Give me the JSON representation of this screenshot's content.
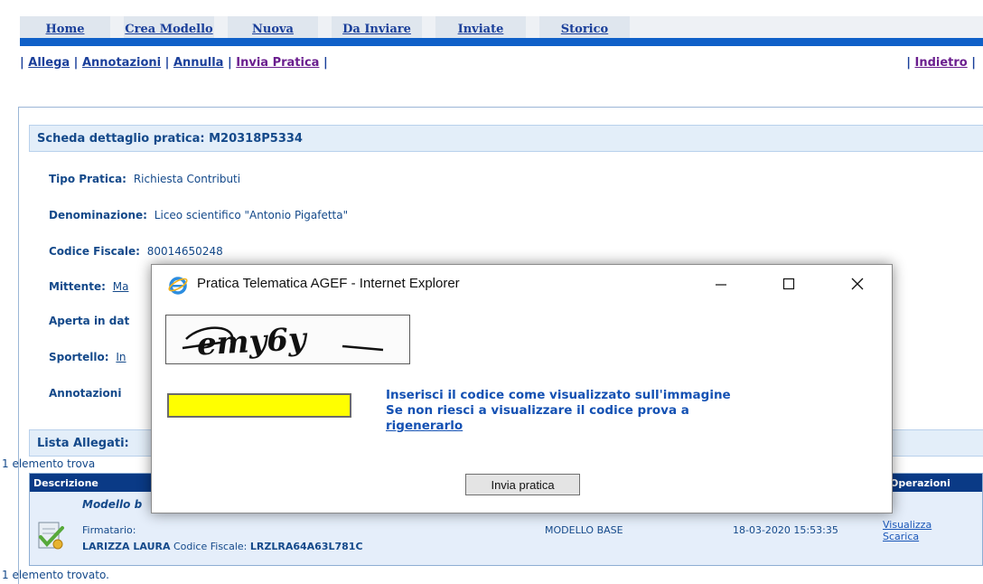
{
  "nav": {
    "tabs": [
      "Home",
      "Crea Modello",
      "Nuova",
      "Da Inviare",
      "Inviate",
      "Storico"
    ]
  },
  "actions": {
    "allega": "Allega",
    "annotazioni": "Annotazioni",
    "annulla": "Annulla",
    "invia_pratica": "Invia Pratica",
    "indietro": "Indietro"
  },
  "scheda": {
    "title": "Scheda dettaglio pratica: M20318P5334",
    "tipo_label": "Tipo Pratica:",
    "tipo_value": "Richiesta Contributi",
    "denominazione_label": "Denominazione:",
    "denominazione_value": "Liceo scientifico \"Antonio Pigafetta\"",
    "cf_label": "Codice Fiscale:",
    "cf_value": "80014650248",
    "mittente_label": "Mittente:",
    "mittente_value": "Ma",
    "aperta_label": "Aperta in dat",
    "sportello_label": "Sportello:",
    "sportello_value": "In",
    "annotazioni_label": "Annotazioni"
  },
  "allegati": {
    "title": "Lista Allegati:",
    "count_top": "1 elemento trova",
    "count_bottom": "1 elemento trovato.",
    "headers": {
      "descrizione": "Descrizione",
      "operazioni": "Operazioni"
    },
    "row": {
      "modello": "Modello b",
      "firmatario_label": "Firmatario:",
      "firmatario_name": "LARIZZA LAURA",
      "cf_label": "Codice Fiscale:",
      "cf_value": "LRZLRA64A63L781C",
      "tipo": "MODELLO BASE",
      "data": "18-03-2020 15:53:35",
      "visualizza": "Visualizza",
      "scarica": "Scarica"
    }
  },
  "dialog": {
    "title": "Pratica Telematica AGEF - Internet Explorer",
    "captcha_text": "emy6y",
    "input_value": "",
    "instr_line1": "Inserisci il codice come visualizzato sull'immagine",
    "instr_line2": "Se non riesci a visualizzare il codice prova a",
    "rigenera_link": "rigenerarlo",
    "send_button": "Invia pratica"
  },
  "colors": {
    "accent": "#0f60c8",
    "header_dark": "#0a3a86",
    "input_highlight": "#ffff00"
  }
}
